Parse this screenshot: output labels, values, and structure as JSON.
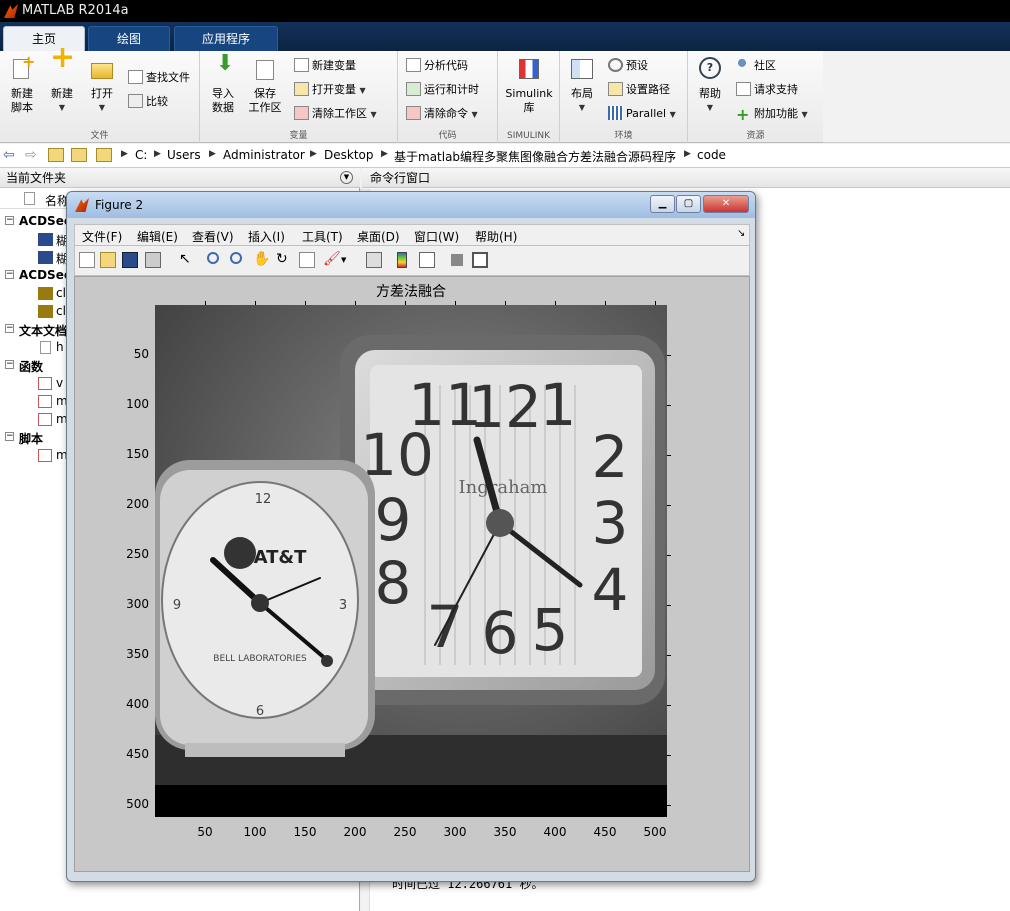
{
  "app": {
    "title": "MATLAB R2014a"
  },
  "tabs": [
    {
      "label": "主页",
      "active": true
    },
    {
      "label": "绘图"
    },
    {
      "label": "应用程序"
    }
  ],
  "ribbon": {
    "file_group": {
      "label": "文件",
      "new_script": [
        "新建",
        "脚本"
      ],
      "new": "新建",
      "open": "打开",
      "find_files": "查找文件",
      "compare": "比较"
    },
    "variable_group": {
      "label": "变量",
      "import": [
        "导入",
        "数据"
      ],
      "save_ws": [
        "保存",
        "工作区"
      ],
      "new_var": "新建变量",
      "open_var": "打开变量",
      "clear_ws": "清除工作区"
    },
    "code_group": {
      "label": "代码",
      "analyze": "分析代码",
      "run_time": "运行和计时",
      "clear_cmd": "清除命令"
    },
    "simulink_group": {
      "label": "SIMULINK",
      "lib": [
        "Simulink",
        "库"
      ]
    },
    "env_group": {
      "label": "环境",
      "layout": "布局",
      "prefs": "预设",
      "set_path": "设置路径",
      "parallel": "Parallel"
    },
    "res_group": {
      "label": "资源",
      "help": "帮助",
      "community": "社区",
      "support": "请求支持",
      "addons": "附加功能"
    }
  },
  "address": {
    "crumbs": [
      "C:",
      "Users",
      "Administrator",
      "Desktop",
      "基于matlab编程多聚焦图像融合方差法融合源码程序",
      "code"
    ]
  },
  "current_folder": {
    "title": "当前文件夹",
    "column_name": "名称",
    "groups": [
      {
        "label": "ACDSee",
        "items": [
          "糊",
          "糊"
        ]
      },
      {
        "label": "ACDSee",
        "items": [
          "cl",
          "cl"
        ]
      },
      {
        "label": "文本文档",
        "items": [
          "h"
        ]
      },
      {
        "label": "函数",
        "items": [
          "v",
          "m",
          "m"
        ]
      },
      {
        "label": "脚本",
        "items": [
          "m"
        ]
      }
    ]
  },
  "command_window": {
    "title": "命令行窗口",
    "last_line": "时间已过 12.266761 秒。"
  },
  "figure": {
    "title": "Figure 2",
    "menu": [
      "文件(F)",
      "编辑(E)",
      "查看(V)",
      "插入(I)",
      "工具(T)",
      "桌面(D)",
      "窗口(W)",
      "帮助(H)"
    ],
    "plot_title": "方差法融合",
    "yticks": [
      "50",
      "100",
      "150",
      "200",
      "250",
      "300",
      "350",
      "400",
      "450",
      "500"
    ],
    "xticks": [
      "50",
      "100",
      "150",
      "200",
      "250",
      "300",
      "350",
      "400",
      "450",
      "500"
    ]
  },
  "image": {
    "left_clock": {
      "brand": "AT&T",
      "sub": "BELL LABORATORIES",
      "numbers": [
        "12",
        "3",
        "6",
        "9"
      ]
    },
    "right_clock": {
      "brand": "Ingraham",
      "numbers": [
        "11",
        "12",
        "1",
        "10",
        "2",
        "9",
        "3",
        "8",
        "4",
        "7",
        "6",
        "5"
      ]
    }
  }
}
